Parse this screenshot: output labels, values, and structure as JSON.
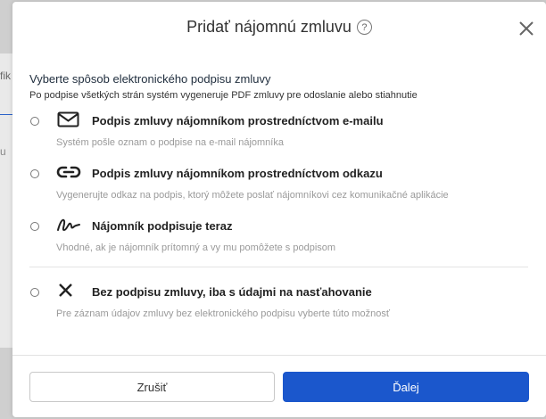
{
  "background": {
    "fragment_text_1": "fik",
    "fragment_text_2": "u"
  },
  "dialog": {
    "title": "Pridať nájomnú zmluvu",
    "help_glyph": "?",
    "heading": "Vyberte spôsob elektronického podpisu zmluvy",
    "subheading": "Po podpise všetkých strán systém vygeneruje PDF zmluvy pre odoslanie alebo stiahnutie",
    "options": [
      {
        "icon": "envelope-icon",
        "label": "Podpis zmluvy nájomníkom prostredníctvom e-mailu",
        "description": "Systém pošle oznam o podpise na e-mail nájomníka"
      },
      {
        "icon": "link-icon",
        "label": "Podpis zmluvy nájomníkom prostredníctvom odkazu",
        "description": "Vygenerujte odkaz na podpis, ktorý môžete poslať nájomníkovi cez komunikačné aplikácie"
      },
      {
        "icon": "signature-icon",
        "label": "Nájomník podpisuje teraz",
        "description": "Vhodné, ak je nájomník prítomný a vy mu pomôžete s podpisom"
      },
      {
        "icon": "x-icon",
        "label": "Bez podpisu zmluvy, iba s údajmi na nasťahovanie",
        "description": "Pre záznam údajov zmluvy bez elektronického podpisu vyberte túto možnosť"
      }
    ],
    "cancel_label": "Zrušiť",
    "next_label": "Ďalej"
  },
  "colors": {
    "primary": "#1b57cc",
    "overlay": "#cfcfcf",
    "description_text": "#9a9a9a"
  }
}
